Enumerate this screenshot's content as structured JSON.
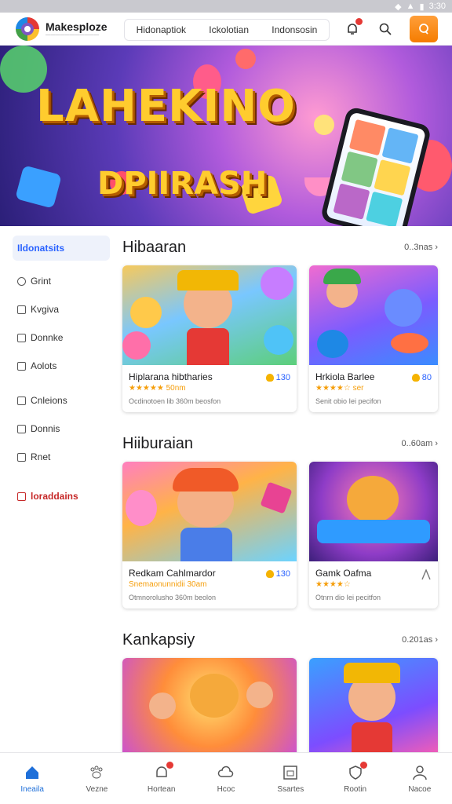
{
  "status_bar": {
    "time": "3:30"
  },
  "header": {
    "brand_name": "Makesploze",
    "brand_tagline": "———————————",
    "nav_items": [
      "Hidonaptiok",
      "Ickolotian",
      "Indonsosin"
    ],
    "icons": [
      "bell-icon",
      "search-icon",
      "profile-icon"
    ]
  },
  "banner": {
    "title": "LAHEKINO",
    "subtitle": "DPIIRASH"
  },
  "sidebar": {
    "items": [
      {
        "label": "Ildonatsits",
        "icon": "home-icon"
      },
      {
        "label": "Grint",
        "icon": "grid-icon"
      },
      {
        "label": "Kvgiva",
        "icon": "paw-icon"
      },
      {
        "label": "Donnke",
        "icon": "bookmark-icon"
      },
      {
        "label": "Aolots",
        "icon": "chart-icon"
      },
      {
        "label": "Cnleions",
        "icon": "message-icon"
      },
      {
        "label": "Donnis",
        "icon": "copy-icon"
      },
      {
        "label": "Rnet",
        "icon": "house-icon"
      },
      {
        "label": "loraddains",
        "icon": "flag-icon"
      }
    ]
  },
  "sections": [
    {
      "title": "Hibaaran",
      "more": "0..3nas",
      "cards": [
        {
          "title": "Hiplarana hibtharies",
          "rating": "★★★★★ 50nm",
          "count": "130",
          "desc": "Ocdinotoen lib 360m beosfon"
        },
        {
          "title": "Hrkiola Barlee",
          "rating": "★★★★☆ ser",
          "count": "80",
          "desc": "Senit obio Iei pecifon"
        }
      ]
    },
    {
      "title": "Hiiburaian",
      "more": "0..60am",
      "cards": [
        {
          "title": "Redkam Cahlmardor",
          "rating": "Snemaonunnidii 30am",
          "count": "130",
          "desc": "Otmnorolusho 360m beolon"
        },
        {
          "title": "Gamk Oafma",
          "rating": "★★★★☆",
          "count": "",
          "desc": "Otnrn dio Iei pecitfon"
        }
      ]
    },
    {
      "title": "Kankapsiy",
      "more": "0.201as"
    }
  ],
  "bottom_nav": [
    {
      "label": "Ineaila",
      "icon": "home-icon",
      "active": true
    },
    {
      "label": "Vezne",
      "icon": "paw-icon"
    },
    {
      "label": "Hortean",
      "icon": "bell-icon"
    },
    {
      "label": "Hcoc",
      "icon": "cloud-icon"
    },
    {
      "label": "Ssartes",
      "icon": "frame-icon"
    },
    {
      "label": "Rootin",
      "icon": "shield-icon"
    },
    {
      "label": "Nacoe",
      "icon": "person-icon"
    }
  ]
}
